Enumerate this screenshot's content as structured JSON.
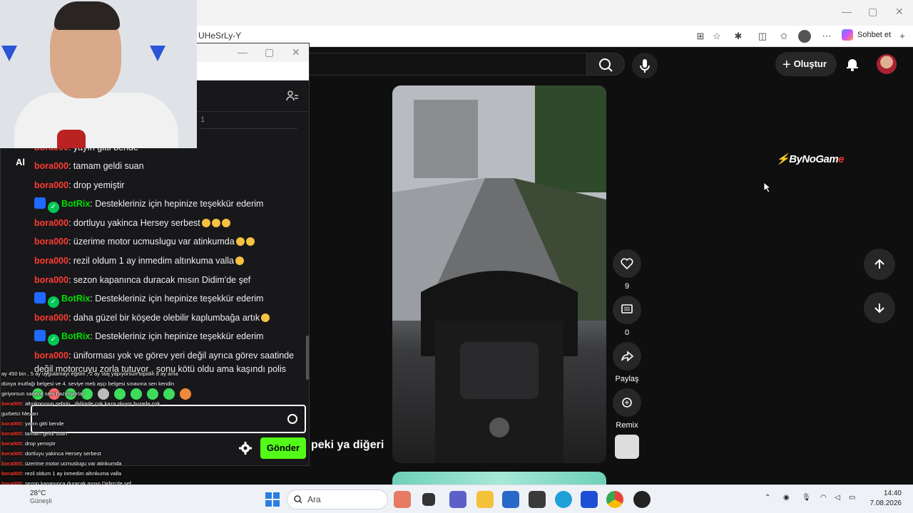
{
  "browser": {
    "url_fragment": "UHeSrLy-Y",
    "copilot_label": "Sohbet et"
  },
  "youtube": {
    "create_label": "Oluştur",
    "short_title": "peki ya diğeri",
    "actions": {
      "like_count": "9",
      "comment_count": "0",
      "share_label": "Paylaş",
      "remix_label": "Remix"
    },
    "watermark_pre": "ByNoGam",
    "watermark_post": "e"
  },
  "chat": {
    "sub_text": "1",
    "partial_top": "yayın gitti bende",
    "messages": [
      {
        "user": "bora000",
        "text": ": tamam geldi suan",
        "bot": false,
        "emotes": 0
      },
      {
        "user": "bora000",
        "text": ": drop yemiştir",
        "bot": false,
        "emotes": 0
      },
      {
        "user": "BotRix",
        "text": ": Destekleriniz için hepinize teşekkür ederim",
        "bot": true,
        "emotes": 0
      },
      {
        "user": "bora000",
        "text": ": dortluyu yakinca Hersey serbest",
        "bot": false,
        "emotes": 3
      },
      {
        "user": "bora000",
        "text": ": üzerime motor ucmuslugu var atinkumda",
        "bot": false,
        "emotes": 2
      },
      {
        "user": "bora000",
        "text": ": rezil oldum 1 ay inmedim altınkuma valla",
        "bot": false,
        "emotes": 1
      },
      {
        "user": "bora000",
        "text": ": sezon kapanınca duracak mısın Didim'de şef",
        "bot": false,
        "emotes": 0
      },
      {
        "user": "BotRix",
        "text": ": Destekleriniz için hepinize teşekkür ederim",
        "bot": true,
        "emotes": 0
      },
      {
        "user": "bora000",
        "text": ": daha güzel bir köşede olebilir kaplumbağa artık",
        "bot": false,
        "emotes": 1
      },
      {
        "user": "BotRix",
        "text": ": Destekleriniz için hepinize teşekkür ederim",
        "bot": true,
        "emotes": 0
      },
      {
        "user": "bora000",
        "text": ": üniforması yok ve görev yeri değil ayrıca görev saatinde",
        "bot": false,
        "emotes": 0
      }
    ],
    "wrap_line": "değil motorcuyu zorla tutuyor , sonu kötü oldu ama kaşındı polis",
    "send_label": "Gönder"
  },
  "overlay": {
    "lines": [
      {
        "user": "",
        "text": "ay 450 bin , 5 ay uygulamayı eğitim , 2 ay staj yapıyorsun topidin 8 ay ama"
      },
      {
        "user": "",
        "text": "dünya mutfağı belgesi ve 4. seviye meb aşçı belgesi sınavına sen kendin"
      },
      {
        "user": "",
        "text": "giriyorsun sadece seni hazırlıyorlar"
      },
      {
        "user": "bora000",
        "text": ": altınkorusun şehrin , didimde çok kaza oluyor burada çok"
      },
      {
        "user": "",
        "text": "gurbetci Mezarı"
      },
      {
        "user": "bora000",
        "text": ": yayın gitti bende"
      },
      {
        "user": "bora000",
        "text": ": tamam geldi suan"
      },
      {
        "user": "bora000",
        "text": ": drop yemiştir"
      },
      {
        "user": "bora000",
        "text": ": dortluyu yakinca Hersey serbest"
      },
      {
        "user": "bora000",
        "text": ": üzerime motor ucmuslugu var atinkumda"
      },
      {
        "user": "bora000",
        "text": ": rezil oldum 1 ay inmedim altınkuma valla"
      },
      {
        "user": "bora000",
        "text": ": sezon kapanınca duracak mısın Didim'de şef"
      },
      {
        "user": "bora000",
        "text": ": daha güzel bir köşede olebilir kaplumbağa artık"
      },
      {
        "user": "bora000",
        "text": ": üniforması yok ve görev yeri değil ayrıca görev saatinde değil"
      },
      {
        "user": "",
        "text": "motorcuyu zorla tutuyor , sonu kötü oldu ama kaşındı polis"
      }
    ]
  },
  "taskbar": {
    "weather_temp": "28°C",
    "weather_desc": "Güneşli",
    "search_label": "Ara",
    "time": "14:40",
    "date": "7.08.2026"
  }
}
